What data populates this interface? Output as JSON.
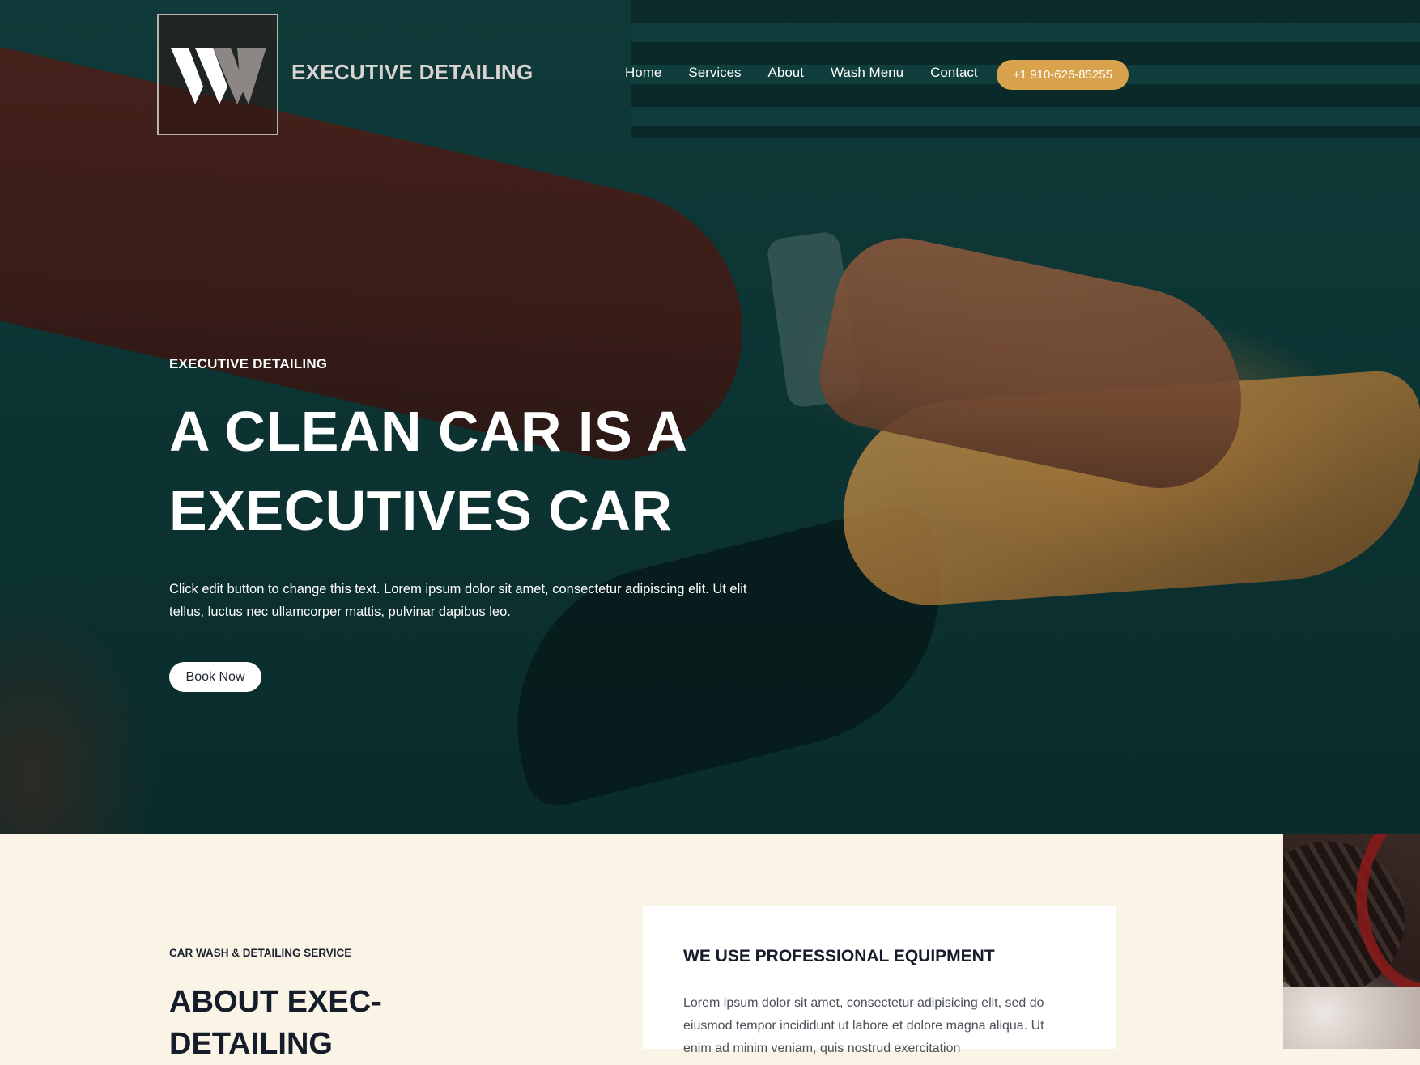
{
  "header": {
    "brand_name": "EXECUTIVE DETAILING",
    "nav": [
      "Home",
      "Services",
      "About",
      "Wash Menu",
      "Contact"
    ],
    "phone": "+1 910-626-85255"
  },
  "hero": {
    "eyebrow": "EXECUTIVE DETAILING",
    "headline_line1": "A CLEAN CAR IS A",
    "headline_line2": "EXECUTIVES CAR",
    "text": "Click edit button to change this text. Lorem ipsum dolor sit amet, consectetur adipiscing elit. Ut elit tellus, luctus nec ullamcorper mattis, pulvinar dapibus leo.",
    "button": "Book Now"
  },
  "about": {
    "eyebrow": "CAR WASH & DETAILING SERVICE",
    "title": "ABOUT EXEC-DETAILING",
    "card_title": "WE USE PROFESSIONAL EQUIPMENT",
    "card_text": "Lorem ipsum dolor sit amet, consectetur adipisicing elit, sed do eiusmod tempor incididunt ut labore et dolore magna aliqua. Ut enim ad minim veniam, quis nostrud exercitation"
  },
  "colors": {
    "hero_overlay": "#0c3433",
    "accent": "#d9a24c",
    "section_bg": "#faf4e6",
    "heading": "#151c2a"
  }
}
